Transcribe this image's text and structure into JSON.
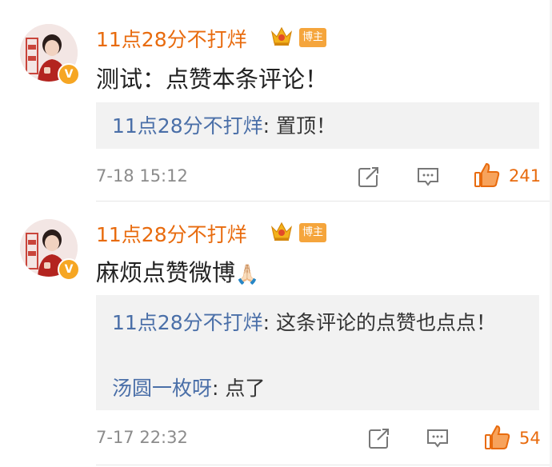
{
  "comments": [
    {
      "username": "11点28分不打烊",
      "badge": "博主",
      "content": "测试：点赞本条评论！",
      "replies": [
        {
          "name": "11点28分不打烊",
          "text": ": 置顶！"
        }
      ],
      "time": "7-18 15:12",
      "likes": "241"
    },
    {
      "username": "11点28分不打烊",
      "badge": "博主",
      "content": "麻烦点赞微博",
      "emoji": "🙏🏻",
      "replies": [
        {
          "name": "11点28分不打烊",
          "text": ": 这条评论的点赞也点点！"
        },
        {
          "name": "汤圆一枚呀",
          "text": ": 点了"
        }
      ],
      "time": "7-17 22:32",
      "likes": "54"
    }
  ],
  "colors": {
    "accent": "#e86b0e",
    "link": "#4a6fa8",
    "reply_bg": "#f2f2f2",
    "badge_bg": "#f5a53c",
    "verified": "#f6a623"
  },
  "icons": [
    "share-icon",
    "comment-icon",
    "like-icon",
    "crown-icon",
    "verified-badge-icon"
  ]
}
